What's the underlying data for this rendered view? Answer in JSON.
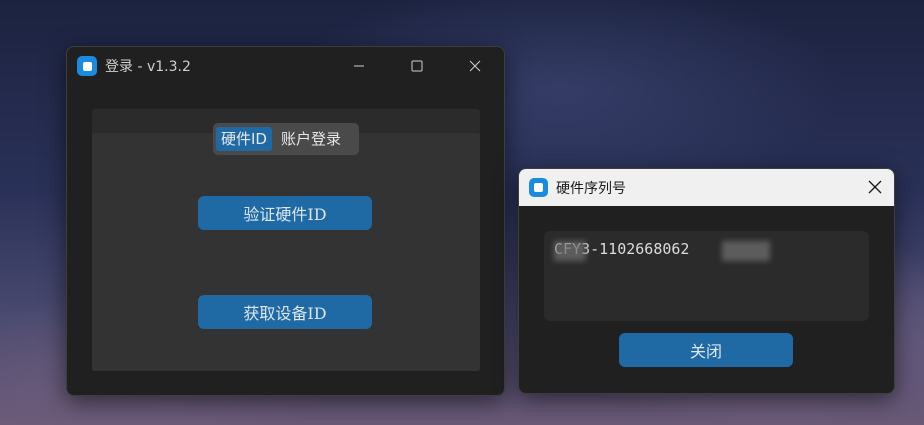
{
  "login_window": {
    "title": "登录 - v1.3.2",
    "controls": {
      "minimize_icon": "minimize-icon",
      "maximize_icon": "maximize-icon",
      "close_icon": "close-icon"
    },
    "tabs": [
      {
        "label": "硬件ID",
        "active": true
      },
      {
        "label": "账户登录",
        "active": false
      }
    ],
    "verify_button": "验证硬件ID",
    "get_device_id_button": "获取设备ID"
  },
  "serial_window": {
    "title": "硬件序列号",
    "serial_value": "CFY3-1102668062",
    "close_button": "关闭"
  },
  "colors": {
    "accent": "#1f6aa5",
    "window_bg": "#202020",
    "panel_bg": "#2b2b2b",
    "inner_panel_bg": "#333333",
    "app_icon": "#1a8ce0"
  }
}
